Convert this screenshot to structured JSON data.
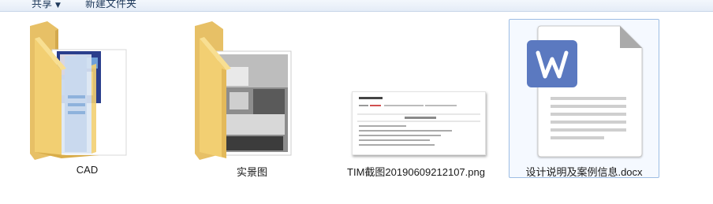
{
  "toolbar": {
    "share_label": "共享",
    "new_folder_label": "新建文件夹"
  },
  "files": [
    {
      "name": "CAD",
      "type": "folder",
      "selected": false
    },
    {
      "name": "实景图",
      "type": "folder",
      "selected": false
    },
    {
      "name": "TIM截图20190609212107.png",
      "type": "image",
      "selected": false
    },
    {
      "name": "设计说明及案例信息.docx",
      "type": "docx",
      "selected": true
    }
  ],
  "colors": {
    "folder": "#f2cf72",
    "word_icon": "#5b79c0",
    "selection_border": "#9dbde4"
  }
}
